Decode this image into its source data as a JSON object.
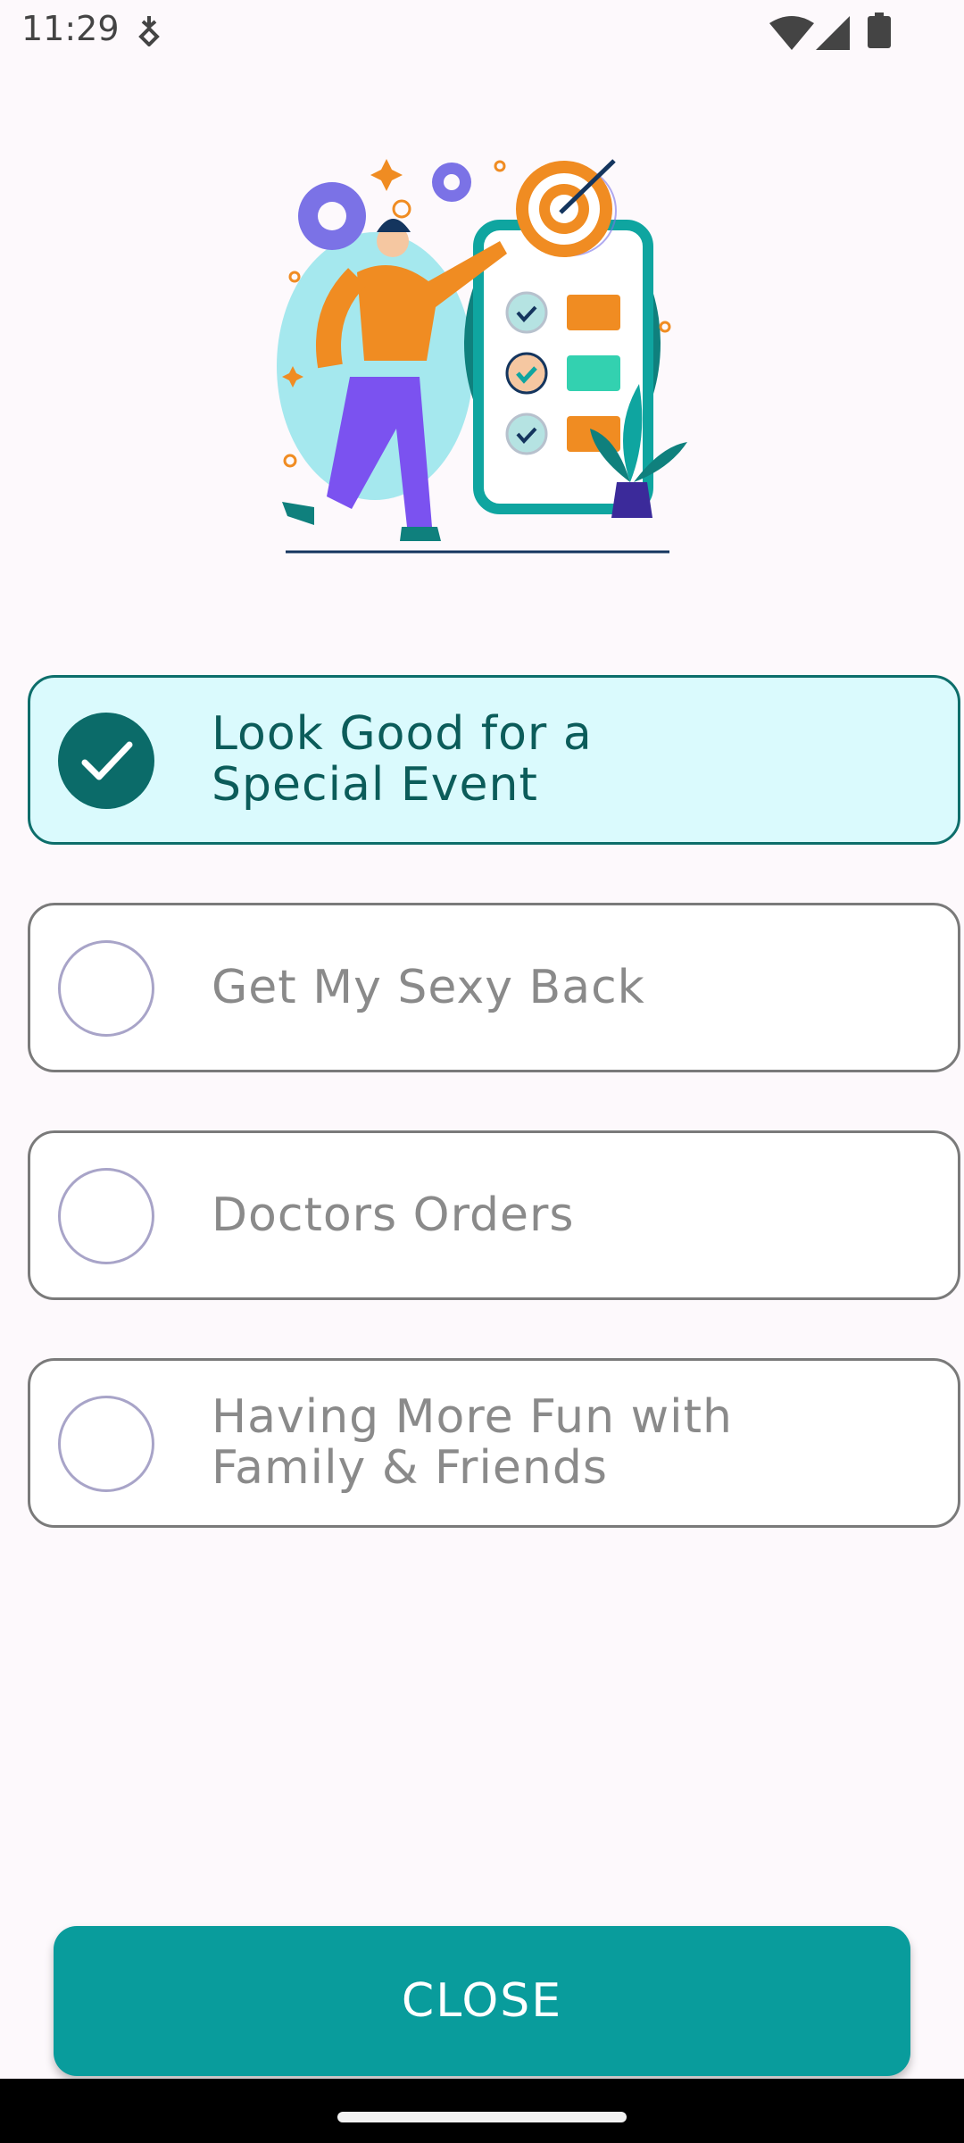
{
  "status_bar": {
    "time": "11:29"
  },
  "options": [
    {
      "label": "Look Good for a\nSpecial Event",
      "selected": true
    },
    {
      "label": "Get My Sexy Back",
      "selected": false
    },
    {
      "label": "Doctors Orders",
      "selected": false
    },
    {
      "label": "Having More Fun with\nFamily & Friends",
      "selected": false
    }
  ],
  "close_button": {
    "label": "CLOSE"
  },
  "colors": {
    "accent": "#099c9c",
    "selected_border": "#0d6e6b",
    "selected_bg": "#dafafd"
  },
  "icons": {
    "status_left": "data-saver-icon",
    "status_right": [
      "wifi-icon",
      "cell-signal-icon",
      "battery-icon"
    ],
    "selected": "check-icon"
  }
}
